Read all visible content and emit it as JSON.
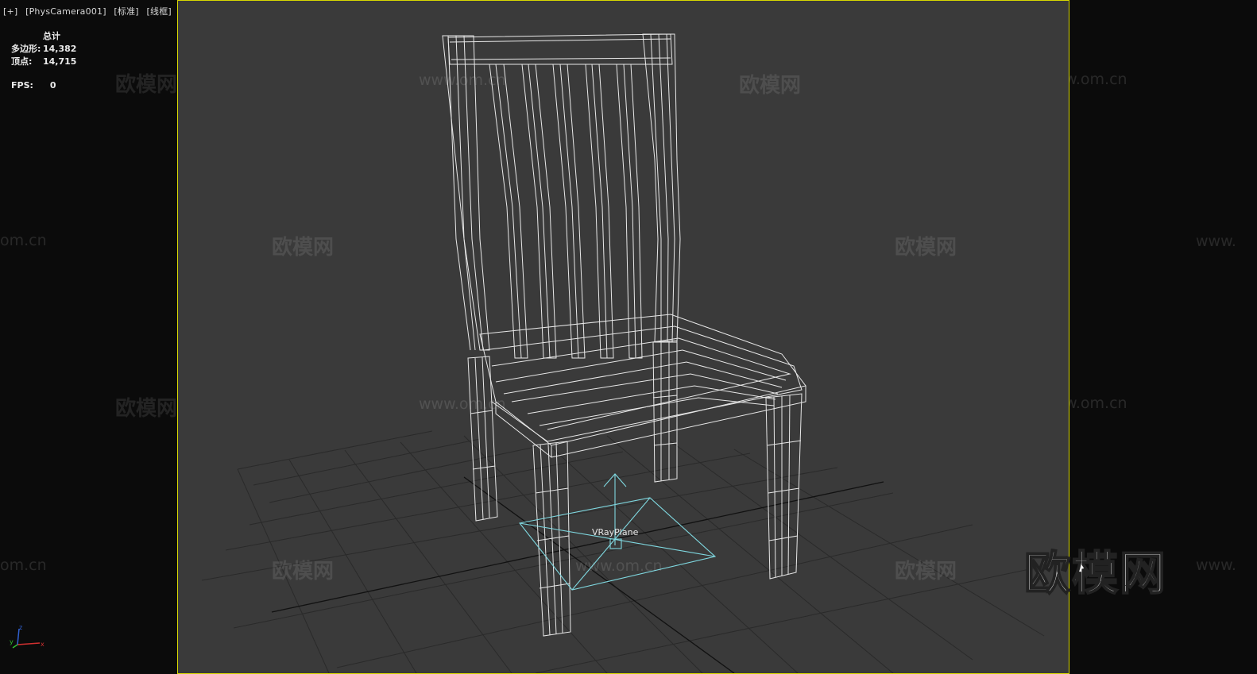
{
  "viewport_label": {
    "plus": "[+]",
    "camera": "[PhysCamera001]",
    "shading": "[标准]",
    "mode": "[线框]"
  },
  "stats": {
    "header": "总计",
    "polygons_label": "多边形:",
    "polygons_value": "14,382",
    "vertices_label": "顶点:",
    "vertices_value": "14,715",
    "fps_label": "FPS:",
    "fps_value": "0"
  },
  "scene": {
    "object_label": "VRayPlane",
    "wireframe_color": "#e8e8e8",
    "helper_color": "#7fd8e0",
    "grid_color": "#2a2a2a"
  },
  "watermarks": {
    "brand": "欧模网",
    "url": "www.om.cn",
    "url_partial": "om.cn",
    "url_left": "www.",
    "url_center": "www.om.cn"
  },
  "logo": {
    "text": "欧模网"
  },
  "axis": {
    "x": "x",
    "y": "y",
    "z": "z"
  },
  "colors": {
    "viewport_border": "#d8d800",
    "viewport_bg": "#3a3a3a",
    "outer_bg": "#0b0b0b"
  }
}
